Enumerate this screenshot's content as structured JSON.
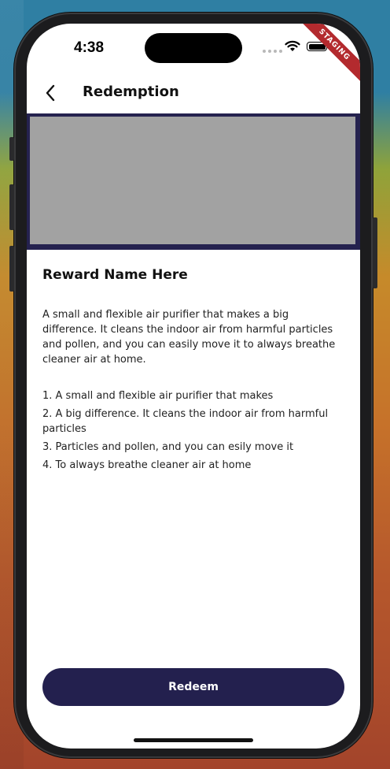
{
  "status_bar": {
    "time": "4:38",
    "badge": "STAGING"
  },
  "nav": {
    "title": "Redemption",
    "back_icon": "chevron-left-icon"
  },
  "reward": {
    "name": "Reward Name Here",
    "description": "A small and flexible air purifier that makes a big difference. It cleans the indoor air from harmful particles and pollen, and you can easily move it to always breathe cleaner air at home.",
    "details": [
      "1. A small and flexible air purifier that makes",
      "2. A big difference. It cleans the indoor air from harmful particles",
      "3. Particles and pollen, and you can esily move it",
      "4. To always breathe cleaner air at home"
    ]
  },
  "actions": {
    "redeem_label": "Redeem"
  },
  "colors": {
    "primary": "#23204e",
    "image_placeholder": "#a2a2a2",
    "staging_badge": "#b32a2e"
  }
}
